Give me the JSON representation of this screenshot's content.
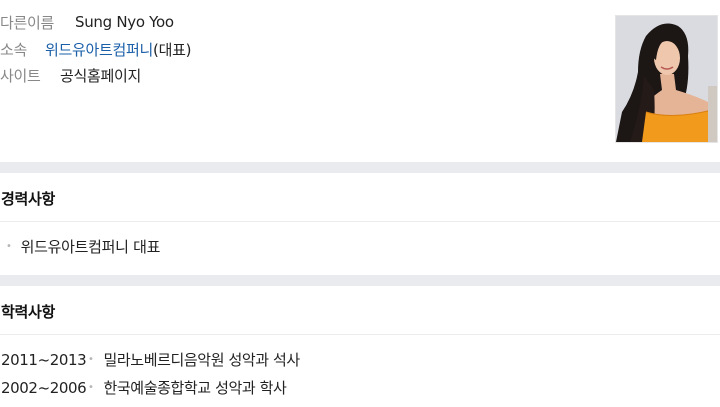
{
  "profile": {
    "alias_label": "다른이름",
    "alias_value": "Sung Nyo Yoo",
    "affiliation_label": "소속",
    "affiliation_link": "위드유아트컴퍼니",
    "affiliation_suffix": "(대표)",
    "site_label": "사이트",
    "site_link": "공식홈페이지"
  },
  "career": {
    "title": "경력사항",
    "items": [
      "위드유아트컴퍼니 대표"
    ]
  },
  "education": {
    "title": "학력사항",
    "items": [
      {
        "years": "2011~2013",
        "text": "밀라노베르디음악원 성악과 석사"
      },
      {
        "years": "2002~2006",
        "text": "한국예술종합학교 성악과 학사"
      }
    ]
  },
  "colors": {
    "link": "#1a5fa8",
    "label": "#888888",
    "separator": "#e9ebee",
    "dress": "#f29a1c"
  }
}
